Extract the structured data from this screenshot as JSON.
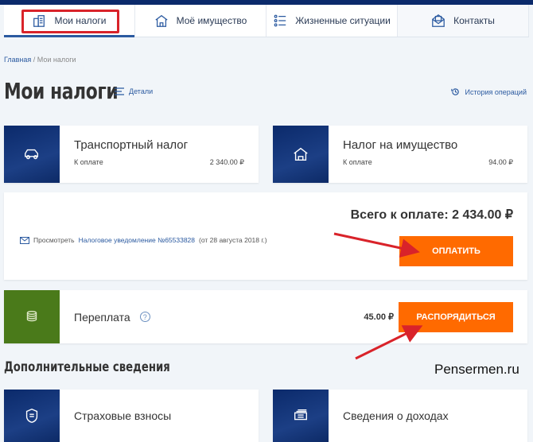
{
  "nav": {
    "tabs": [
      {
        "label": "Мои налоги",
        "icon": "tax-icon"
      },
      {
        "label": "Моё имущество",
        "icon": "house-icon"
      },
      {
        "label": "Жизненные ситуации",
        "icon": "list-icon"
      },
      {
        "label": "Контакты",
        "icon": "mail-icon"
      }
    ]
  },
  "breadcrumb": {
    "home": "Главная",
    "sep": " / ",
    "current": "Мои налоги"
  },
  "page": {
    "title": "Мои налоги",
    "details": "Детали",
    "history": "История операций"
  },
  "taxes": [
    {
      "title": "Транспортный налог",
      "label": "К оплате",
      "amount": "2 340.00 ₽",
      "icon": "car-icon"
    },
    {
      "title": "Налог на имущество",
      "label": "К оплате",
      "amount": "94.00 ₽",
      "icon": "house-icon"
    }
  ],
  "total": {
    "text": "Всего к оплате: 2 434.00 ₽",
    "view": "Просмотреть",
    "notice_link": "Налоговое уведомление №65533828",
    "notice_date": "(от 28 августа 2018 г.)",
    "pay_button": "ОПЛАТИТЬ"
  },
  "overpayment": {
    "title": "Переплата",
    "help": "?",
    "amount": "45.00 ₽",
    "button": "РАСПОРЯДИТЬСЯ"
  },
  "additional": {
    "heading": "Дополнительные сведения",
    "cards": [
      {
        "title": "Страховые взносы"
      },
      {
        "title": "Сведения о доходах"
      }
    ]
  },
  "watermark": "Pensermen.ru",
  "colors": {
    "accent": "#ff6a00",
    "brand": "#0b2a6b",
    "green": "#4a7a1a",
    "annotation": "#d9232a"
  }
}
